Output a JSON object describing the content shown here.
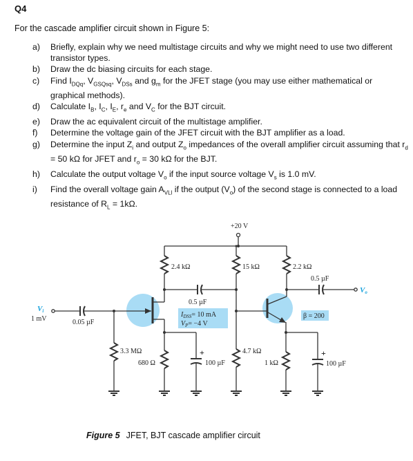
{
  "question": {
    "number": "Q4",
    "intro": "For the cascade amplifier circuit shown in Figure 5:",
    "parts": [
      {
        "label": "a)",
        "text": "Briefly, explain why we need multistage circuits and why we might need to use two different transistor types."
      },
      {
        "label": "b)",
        "text": "Draw the dc biasing circuits for each stage."
      },
      {
        "label": "c)",
        "text": "Find I_DQ, V_GSQ, V_DS and g_m for the JFET stage (you may use either mathematical or graphical methods)."
      },
      {
        "label": "d)",
        "text": "Calculate I_B, I_C, I_E, r_e and V_C for the BJT circuit."
      },
      {
        "label": "e)",
        "text": "Draw the ac equivalent circuit of the multistage amplifier."
      },
      {
        "label": "f)",
        "text": "Determine the voltage gain of the JFET circuit with the BJT amplifier as a load."
      },
      {
        "label": "g)",
        "text": "Determine the input Z_i and output Z_o impedances of the overall amplifier circuit assuming that r_d = 50 kΩ for JFET and r_o = 30 kΩ for the BJT."
      },
      {
        "label": "h)",
        "text": "Calculate the output voltage V_o if the input source voltage V_s is 1.0 mV."
      },
      {
        "label": "i)",
        "text": "Find the overall voltage gain A_VL if the output (V_o) of the second stage is connected to a load resistance of R_L = 1kΩ."
      }
    ]
  },
  "figure": {
    "caption_label": "Figure 5",
    "caption_text": "JFET, BJT cascade amplifier circuit",
    "supply": "+20 V",
    "input": {
      "name": "V",
      "sub": "i",
      "value": "1 mV"
    },
    "output": {
      "name": "V",
      "sub": "o"
    },
    "components": {
      "c_in": "0.05 µF",
      "r_g": "3.3 MΩ",
      "r_d": "2.4 kΩ",
      "r_s": "680 Ω",
      "c_s": "100 µF",
      "c_couple": "0.5 µF",
      "r_b1": "15 kΩ",
      "r_b2": "4.7 kΩ",
      "r_c": "2.2 kΩ",
      "r_e": "1 kΩ",
      "c_e": "100 µF",
      "c_out": "0.5 µF"
    },
    "jfet_params": {
      "idss": "= 10 mA",
      "vp": "= −4 V"
    },
    "bjt_params": {
      "beta": "β = 200"
    },
    "colors": {
      "highlight": "#a9dcf5",
      "label_blue": "#1aa3dd",
      "wire": "#333333"
    }
  }
}
